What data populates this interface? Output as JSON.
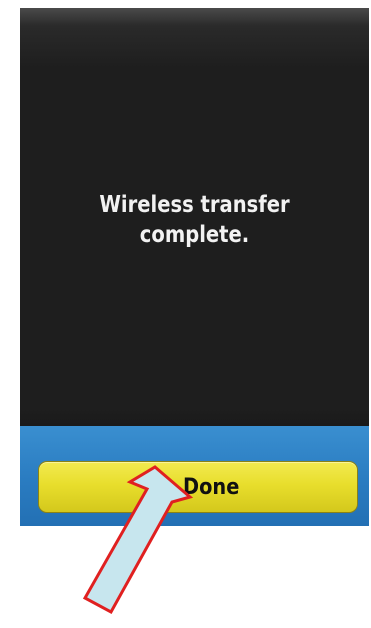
{
  "dialog": {
    "message_line1": "Wireless transfer",
    "message_line2": "complete."
  },
  "actions": {
    "done_label": "Done"
  },
  "colors": {
    "screen_background": "#1e1e1e",
    "message_text": "#f2f2f2",
    "button_bar": "#2b7dc2",
    "done_button": "#e8de2c",
    "annotation_arrow_fill": "#c7e6ee",
    "annotation_arrow_stroke": "#e02020"
  },
  "icons": {
    "annotation": "arrow-pointer-icon"
  }
}
